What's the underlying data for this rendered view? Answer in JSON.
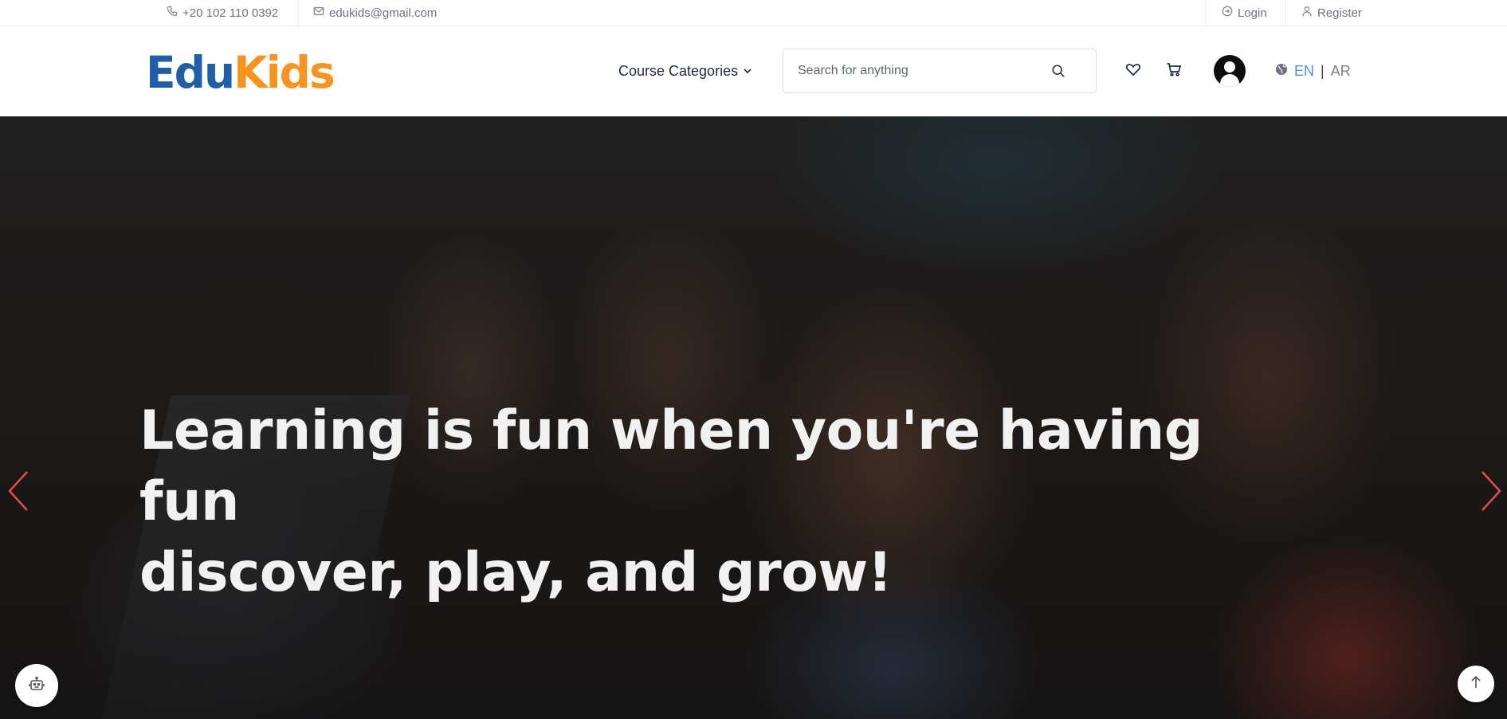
{
  "topbar": {
    "phone": "+20 102 110 0392",
    "email": "edukids@gmail.com",
    "login": "Login",
    "register": "Register"
  },
  "header": {
    "logo_part1": "Edu",
    "logo_part2": "Kids",
    "nav_categories": "Course Categories",
    "search_placeholder": "Search for anything",
    "lang_en": "EN",
    "lang_sep": "|",
    "lang_ar": "AR"
  },
  "hero": {
    "title_line1": "Learning is fun when you're having fun",
    "title_line2": "discover, play, and grow!"
  },
  "icons": {
    "phone": "phone-icon",
    "email": "mail-icon",
    "login": "login-icon",
    "register": "user-icon",
    "search": "search-icon",
    "wishlist": "heart-icon",
    "cart": "cart-icon",
    "language": "globe-icon",
    "chat": "robot-icon",
    "scroll_top": "arrow-up-icon"
  },
  "colors": {
    "logo_primary": "#1f5ea8",
    "logo_accent": "#f7931e",
    "lang_active": "#4a90e2",
    "slider_arrow": "#e64a4a"
  }
}
